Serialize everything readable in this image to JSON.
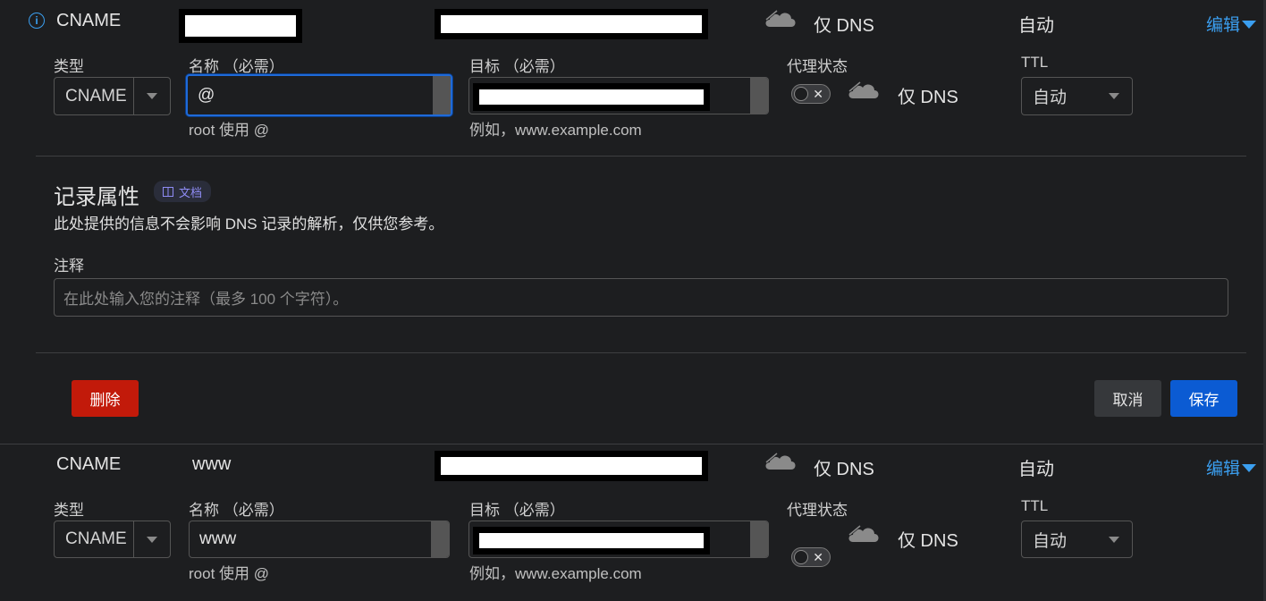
{
  "record1": {
    "type": "CNAME",
    "proxy": "仅 DNS",
    "ttl": "自动",
    "edit": "编辑"
  },
  "form1": {
    "type_label": "类型",
    "type_value": "CNAME",
    "name_label": "名称 （必需）",
    "name_value": "@",
    "name_hint": "root 使用 @",
    "target_label": "目标 （必需）",
    "target_hint": "例如，www.example.com",
    "proxy_label": "代理状态",
    "proxy_value": "仅 DNS",
    "ttl_label": "TTL",
    "ttl_value": "自动"
  },
  "attributes": {
    "title": "记录属性",
    "doc_badge": "文档",
    "description": "此处提供的信息不会影响 DNS 记录的解析，仅供您参考。",
    "comment_label": "注释",
    "comment_placeholder": "在此处输入您的注释（最多 100 个字符）。"
  },
  "actions": {
    "delete": "删除",
    "cancel": "取消",
    "save": "保存"
  },
  "record2": {
    "type": "CNAME",
    "name": "www",
    "proxy": "仅 DNS",
    "ttl": "自动",
    "edit": "编辑"
  },
  "form2": {
    "type_label": "类型",
    "type_value": "CNAME",
    "name_label": "名称 （必需）",
    "name_value": "www",
    "name_hint": "root 使用 @",
    "target_label": "目标 （必需）",
    "target_hint": "例如，www.example.com",
    "proxy_label": "代理状态",
    "proxy_value": "仅 DNS",
    "ttl_label": "TTL",
    "ttl_value": "自动"
  },
  "colors": {
    "accent": "#3b9ff0",
    "save": "#0b5bd3",
    "delete": "#c21a0a",
    "cancel": "#36383b",
    "focus": "#1f6ad8"
  }
}
